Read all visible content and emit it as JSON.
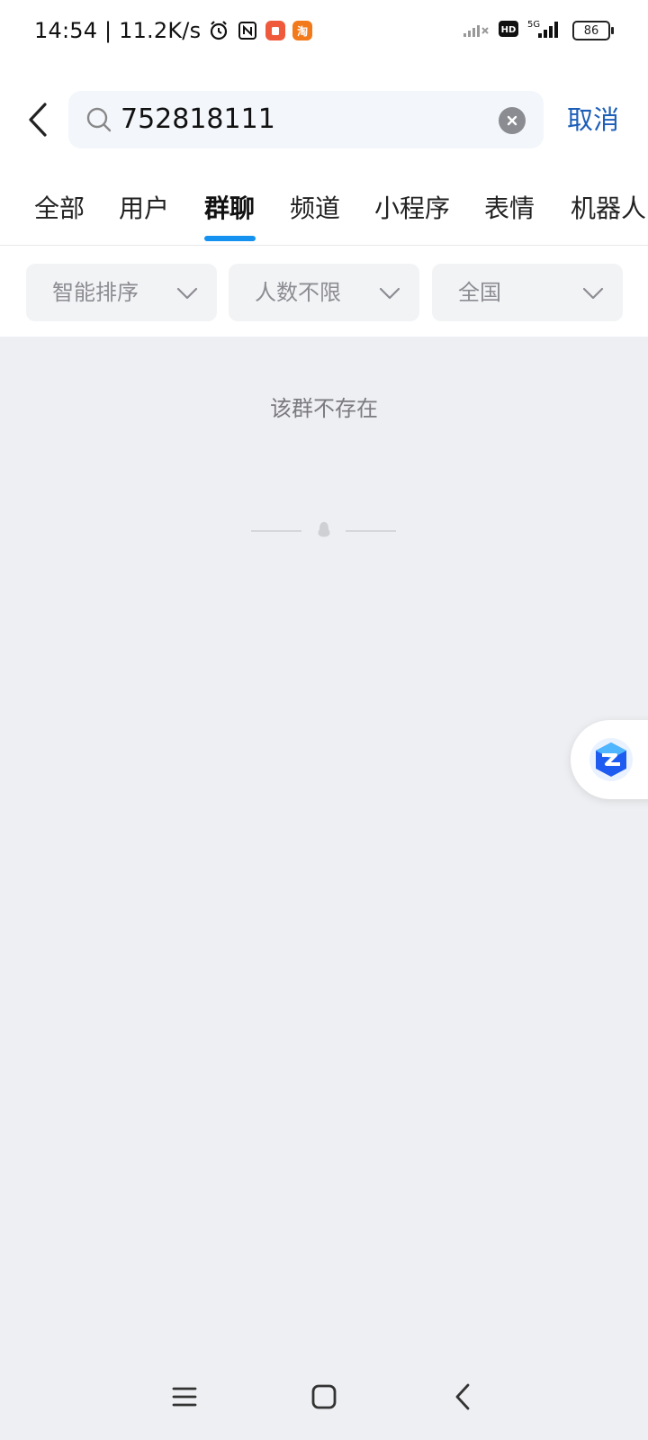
{
  "status_bar": {
    "time_speed": "14:54 | 11.2K/s",
    "battery": "86",
    "icons": [
      "alarm-icon",
      "nfc-icon",
      "app-badge-red-icon",
      "taobao-icon",
      "signal-weak-icon",
      "hd-icon",
      "5g-signal-icon",
      "battery-icon"
    ]
  },
  "header": {
    "search_value": "752818111",
    "cancel_label": "取消"
  },
  "tabs": [
    {
      "label": "全部",
      "active": false
    },
    {
      "label": "用户",
      "active": false
    },
    {
      "label": "群聊",
      "active": true
    },
    {
      "label": "频道",
      "active": false
    },
    {
      "label": "小程序",
      "active": false
    },
    {
      "label": "表情",
      "active": false
    },
    {
      "label": "机器人",
      "active": false
    }
  ],
  "filters": [
    {
      "label": "智能排序"
    },
    {
      "label": "人数不限"
    },
    {
      "label": "全国"
    }
  ],
  "content": {
    "empty_message": "该群不存在"
  },
  "colors": {
    "accent": "#1592F0",
    "cancel_text": "#1D5FB7",
    "background": "#EEEFF2"
  }
}
